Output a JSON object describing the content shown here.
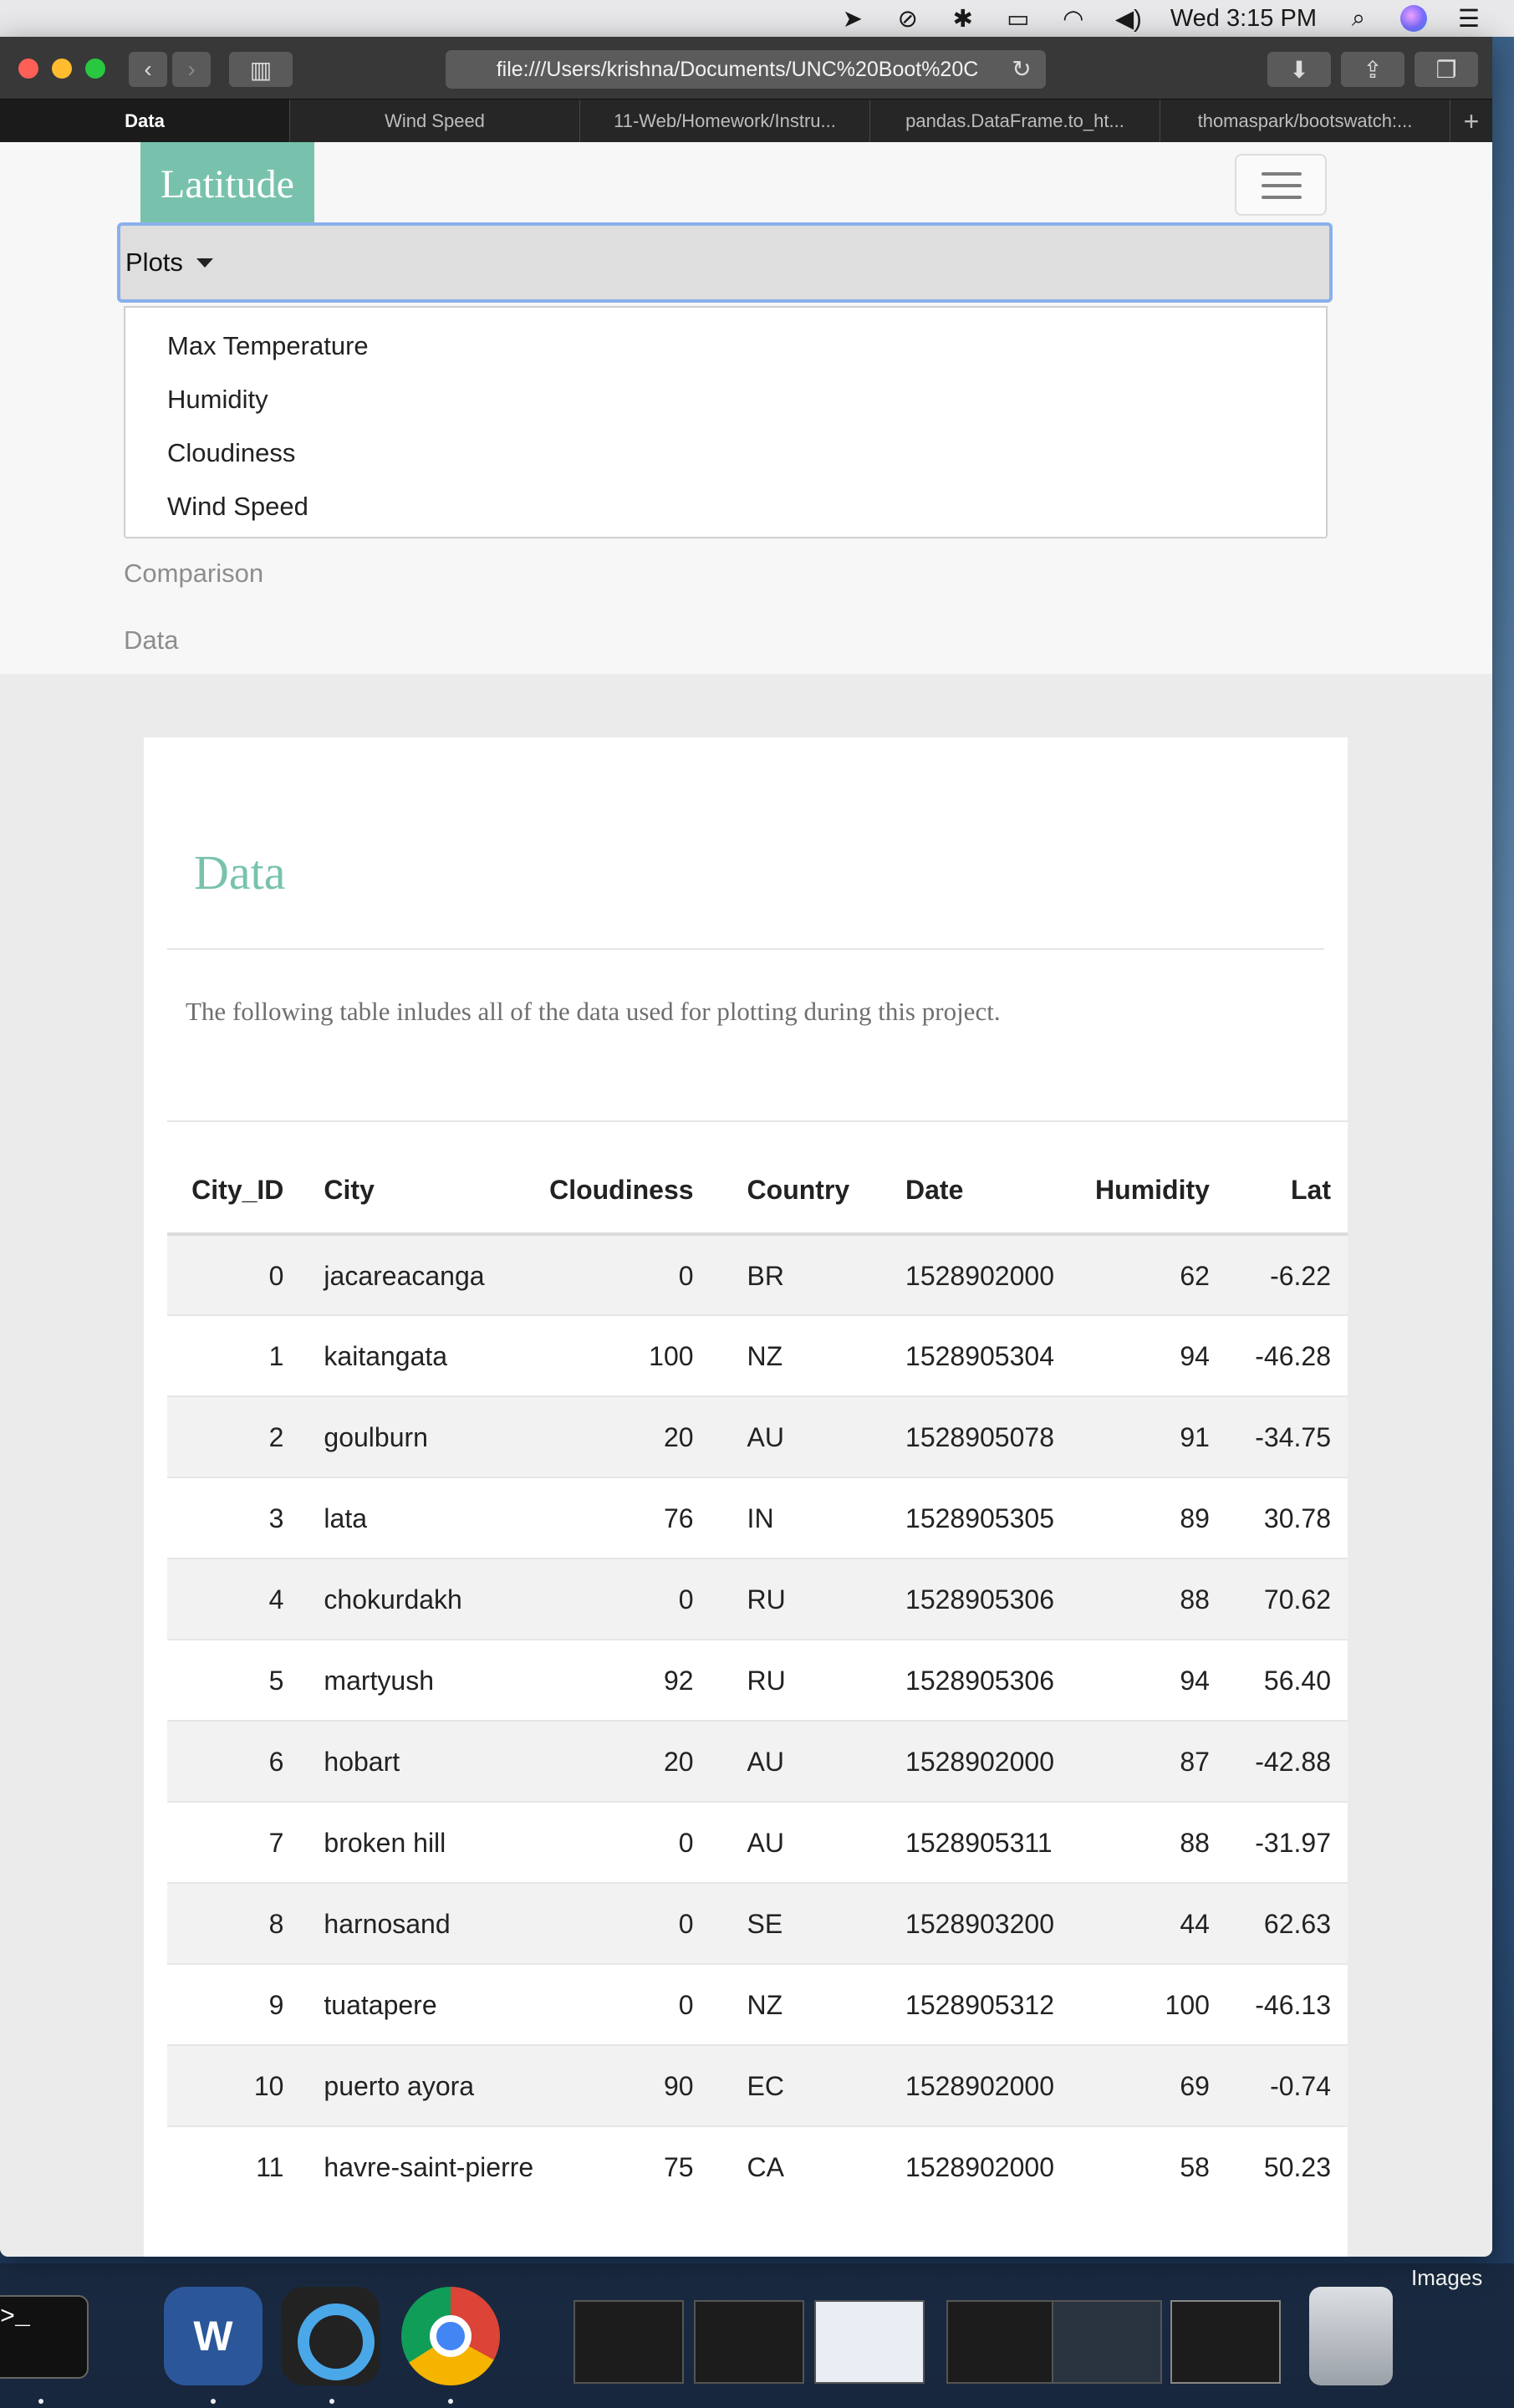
{
  "menubar": {
    "clock": "Wed 3:15 PM"
  },
  "browser": {
    "address": "file:///Users/krishna/Documents/UNC%20Boot%20C",
    "tabs": [
      "Data",
      "Wind Speed",
      "11-Web/Homework/Instru...",
      "pandas.DataFrame.to_ht...",
      "thomaspark/bootswatch:..."
    ]
  },
  "navbar": {
    "brand": "Latitude",
    "plots_label": "Plots",
    "dropdown": [
      "Max Temperature",
      "Humidity",
      "Cloudiness",
      "Wind Speed"
    ],
    "links": [
      "Comparison",
      "Data"
    ]
  },
  "content": {
    "title": "Data",
    "lead": "The following table inludes all of the data used for plotting during this project."
  },
  "table": {
    "headers": [
      "City_ID",
      "City",
      "Cloudiness",
      "Country",
      "Date",
      "Humidity",
      "Lat"
    ],
    "rows": [
      [
        "0",
        "jacareacanga",
        "0",
        "BR",
        "1528902000",
        "62",
        "-6.22"
      ],
      [
        "1",
        "kaitangata",
        "100",
        "NZ",
        "1528905304",
        "94",
        "-46.28"
      ],
      [
        "2",
        "goulburn",
        "20",
        "AU",
        "1528905078",
        "91",
        "-34.75"
      ],
      [
        "3",
        "lata",
        "76",
        "IN",
        "1528905305",
        "89",
        "30.78"
      ],
      [
        "4",
        "chokurdakh",
        "0",
        "RU",
        "1528905306",
        "88",
        "70.62"
      ],
      [
        "5",
        "martyush",
        "92",
        "RU",
        "1528905306",
        "94",
        "56.40"
      ],
      [
        "6",
        "hobart",
        "20",
        "AU",
        "1528902000",
        "87",
        "-42.88"
      ],
      [
        "7",
        "broken hill",
        "0",
        "AU",
        "1528905311",
        "88",
        "-31.97"
      ],
      [
        "8",
        "harnosand",
        "0",
        "SE",
        "1528903200",
        "44",
        "62.63"
      ],
      [
        "9",
        "tuatapere",
        "0",
        "NZ",
        "1528905312",
        "100",
        "-46.13"
      ],
      [
        "10",
        "puerto ayora",
        "90",
        "EC",
        "1528902000",
        "69",
        "-0.74"
      ],
      [
        "11",
        "havre-saint-pierre",
        "75",
        "CA",
        "1528902000",
        "58",
        "50.23"
      ]
    ]
  },
  "dock": {
    "images_label": "Images",
    "word_letter": "W"
  },
  "colors": {
    "accent": "#78c2ad",
    "focus": "#8ab0ec"
  }
}
